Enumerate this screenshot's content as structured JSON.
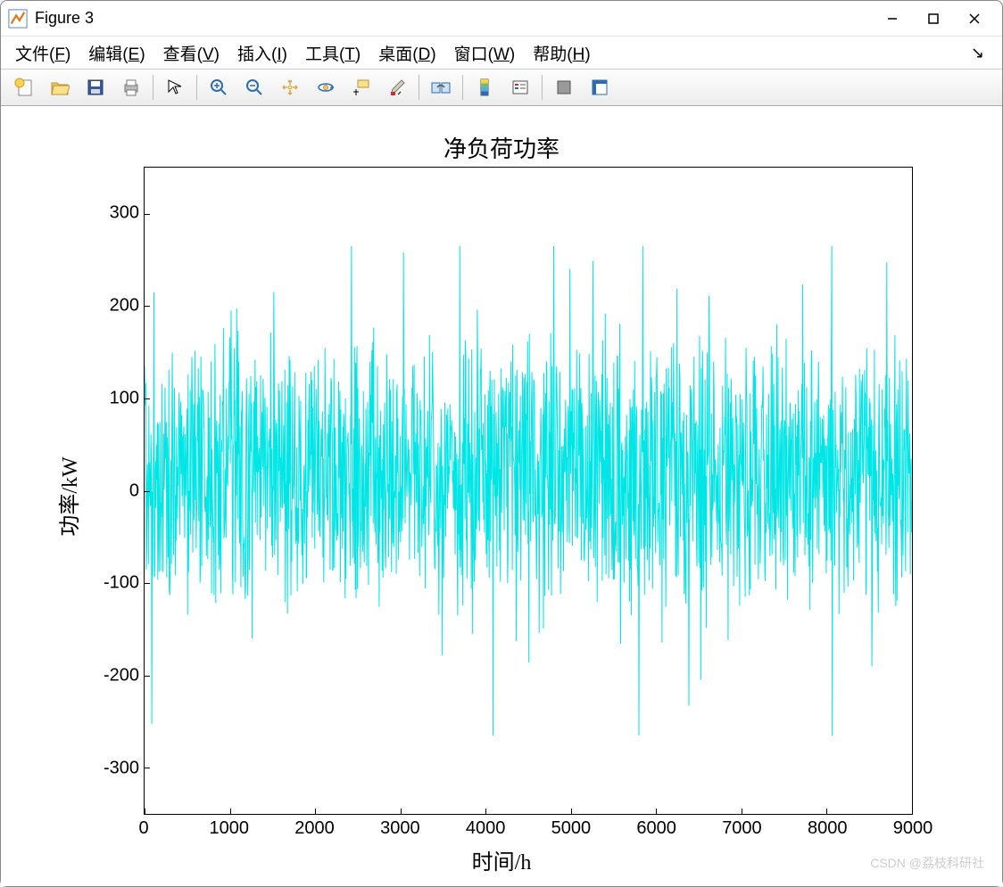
{
  "window": {
    "title": "Figure 3"
  },
  "menubar": {
    "items": [
      {
        "label": "文件",
        "key": "F"
      },
      {
        "label": "编辑",
        "key": "E"
      },
      {
        "label": "查看",
        "key": "V"
      },
      {
        "label": "插入",
        "key": "I"
      },
      {
        "label": "工具",
        "key": "T"
      },
      {
        "label": "桌面",
        "key": "D"
      },
      {
        "label": "窗口",
        "key": "W"
      },
      {
        "label": "帮助",
        "key": "H"
      }
    ]
  },
  "toolbar": {
    "buttons": [
      {
        "name": "new-figure",
        "group": 0
      },
      {
        "name": "open-file",
        "group": 0
      },
      {
        "name": "save-figure",
        "group": 0
      },
      {
        "name": "print-figure",
        "group": 0
      },
      {
        "name": "edit-plot",
        "group": 1
      },
      {
        "name": "zoom-in",
        "group": 2
      },
      {
        "name": "zoom-out",
        "group": 2
      },
      {
        "name": "pan",
        "group": 2
      },
      {
        "name": "rotate-3d",
        "group": 2
      },
      {
        "name": "data-cursor",
        "group": 2
      },
      {
        "name": "brush",
        "group": 2
      },
      {
        "name": "link-plot",
        "group": 3
      },
      {
        "name": "insert-colorbar",
        "group": 4
      },
      {
        "name": "insert-legend",
        "group": 4
      },
      {
        "name": "hide-plot-tools",
        "group": 5
      },
      {
        "name": "show-plot-tools",
        "group": 5
      }
    ]
  },
  "chart_data": {
    "type": "line",
    "title": "净负荷功率",
    "xlabel": "时间/h",
    "ylabel": "功率/kW",
    "xlim": [
      0,
      9000
    ],
    "ylim": [
      -350,
      350
    ],
    "x_ticks": [
      0,
      1000,
      2000,
      3000,
      4000,
      5000,
      6000,
      7000,
      8000,
      9000
    ],
    "y_ticks": [
      -300,
      -200,
      -100,
      0,
      100,
      200,
      300
    ],
    "series": [
      {
        "name": "net-load",
        "color": "#00e5e5",
        "n_points": 8760,
        "mean": 20,
        "amplitude_typical": 120,
        "amplitude_max": 265,
        "note": "dense noisy hourly time series; values estimated from visual envelope"
      }
    ]
  },
  "watermark": "CSDN @荔枝科研社"
}
